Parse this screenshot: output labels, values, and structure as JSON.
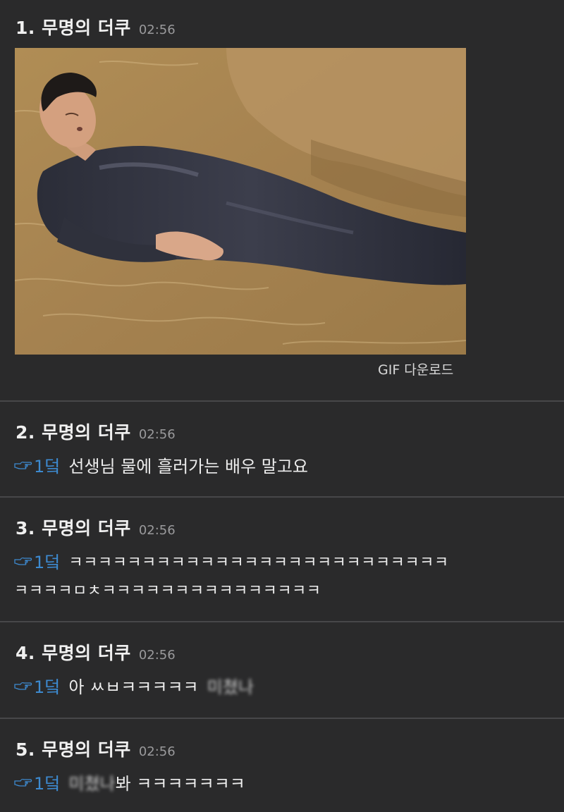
{
  "comments": [
    {
      "number_name": "1. 무명의 더쿠",
      "time": "02:56",
      "gif_label": "GIF 다운로드"
    },
    {
      "number_name": "2. 무명의 더쿠",
      "time": "02:56",
      "reply_ref": "1덬",
      "text": "선생님 물에 흘러가는 배우 말고요"
    },
    {
      "number_name": "3. 무명의 더쿠",
      "time": "02:56",
      "reply_ref": "1덬",
      "text_line1": "ㅋㅋㅋㅋㅋㅋㅋㅋㅋㅋㅋㅋㅋㅋㅋㅋㅋㅋㅋㅋㅋㅋㅋㅋㅋㅋ",
      "text_line2": "ㅋㅋㅋㅋㅁㅊㅋㅋㅋㅋㅋㅋㅋㅋㅋㅋㅋㅋㅋㅋㅋ"
    },
    {
      "number_name": "4. 무명의 더쿠",
      "time": "02:56",
      "reply_ref": "1덬",
      "text": "아 ㅆㅂㅋㅋㅋㅋㅋ",
      "blurred_text": "미쳤나"
    },
    {
      "number_name": "5. 무명의 더쿠",
      "time": "02:56",
      "reply_ref": "1덬",
      "blurred_text": "미쳤나",
      "text": "봐 ㅋㅋㅋㅋㅋㅋㅋ"
    }
  ],
  "icons": {
    "reply": "pointing-hand-icon"
  },
  "colors": {
    "background": "#2a2a2b",
    "divider": "#474749",
    "reply_link": "#3d8ad0",
    "time": "#9a9a9c"
  }
}
